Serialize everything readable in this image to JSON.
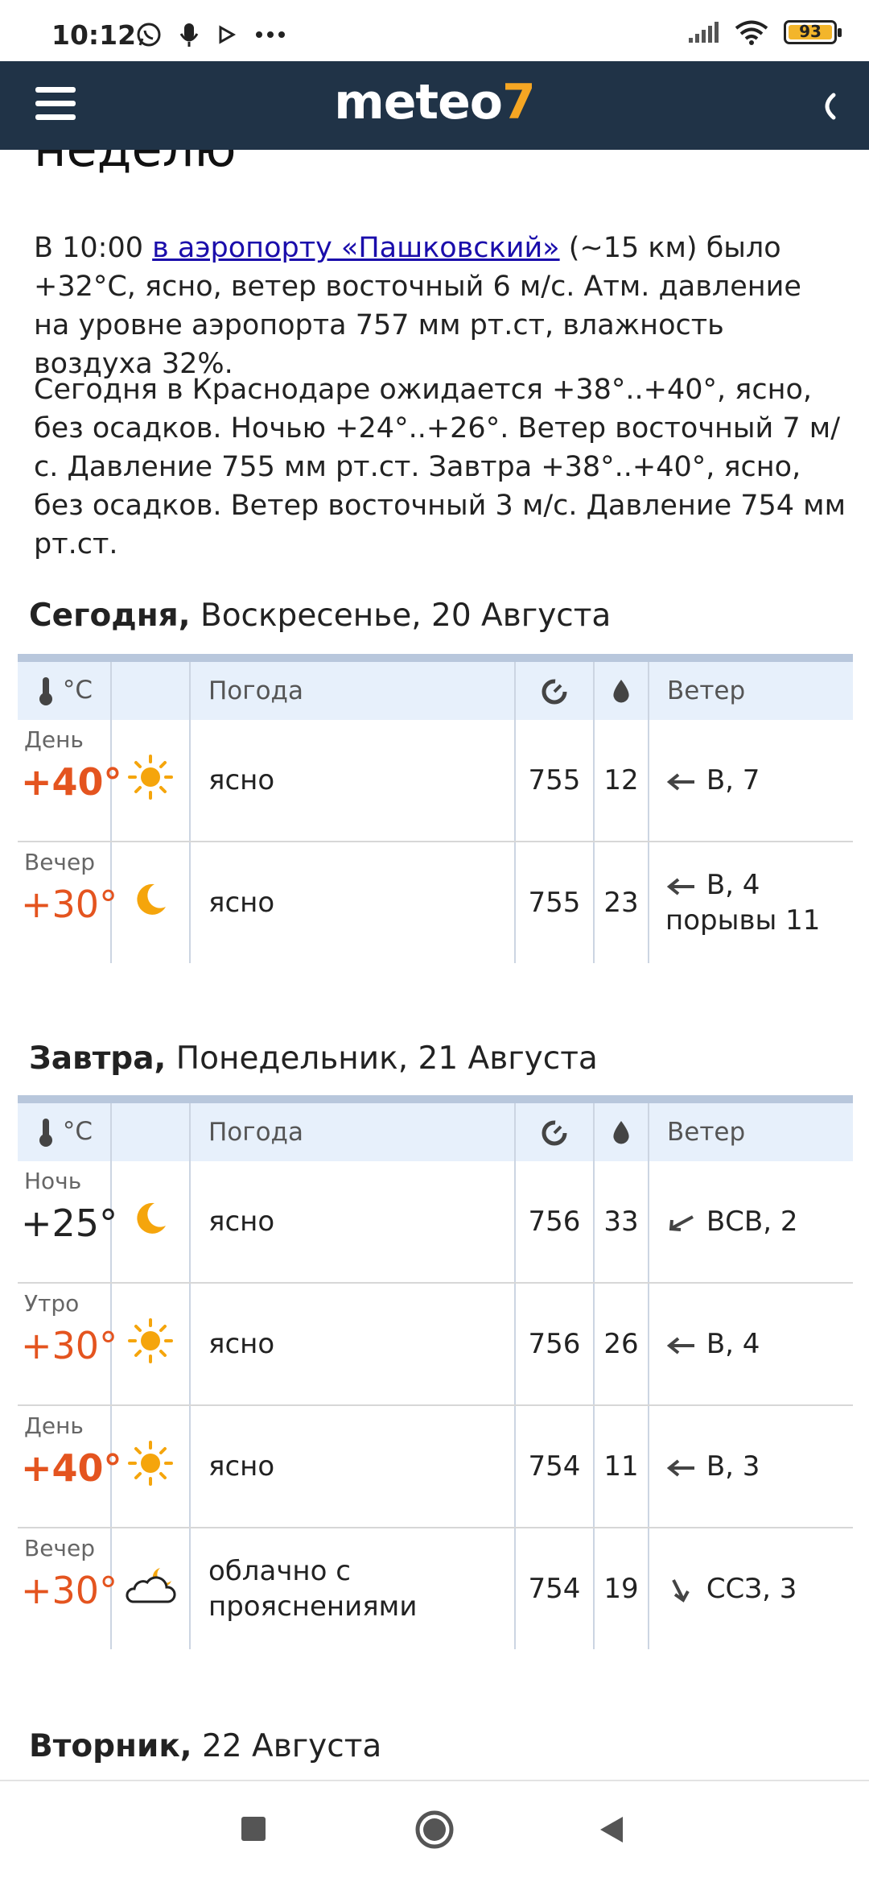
{
  "status_bar": {
    "time": "10:12",
    "battery": "93"
  },
  "header": {
    "logo_main": "meteo",
    "logo_accent": "7"
  },
  "page": {
    "heading_fragment": "неделю",
    "current_prefix": "В 10:00 ",
    "current_link": "в аэропорту «Пашковский»",
    "current_suffix": " (~15 км) было +32°C, ясно, ветер восточный 6 м/с. Атм. давление на уровне аэропорта 757 мм рт.ст, влажность воздуха 32%.",
    "forecast_text": "Сегодня в Краснодаре ожидается +38°..+40°, ясно, без осадков. Ночью +24°..+26°. Ветер восточный 7 м/с. Давление 755 мм рт.ст. Завтра +38°..+40°, ясно, без осадков. Ветер восточный 3 м/с. Давление 754 мм рт.ст."
  },
  "table_headers": {
    "temp_unit": "°C",
    "weather": "Погода",
    "wind": "Ветер"
  },
  "days": [
    {
      "title_bold": "Сегодня,",
      "title_rest": " Воскресенье, 20 Августа",
      "rows": [
        {
          "period": "День",
          "temp": "+40°",
          "icon": "sun-icon",
          "desc": "ясно",
          "pressure": "755",
          "humidity": "12",
          "wind_dir_icon": "arrow-left-icon",
          "wind": "В, 7",
          "gusts": ""
        },
        {
          "period": "Вечер",
          "temp": "+30°",
          "icon": "moon-icon",
          "desc": "ясно",
          "pressure": "755",
          "humidity": "23",
          "wind_dir_icon": "arrow-left-icon",
          "wind": "В, 4",
          "gusts": "порывы 11"
        }
      ]
    },
    {
      "title_bold": "Завтра,",
      "title_rest": " Понедельник, 21 Августа",
      "rows": [
        {
          "period": "Ночь",
          "temp": "+25°",
          "icon": "moon-icon",
          "desc": "ясно",
          "pressure": "756",
          "humidity": "33",
          "wind_dir_icon": "arrow-down-left-icon",
          "wind": "ВСВ, 2",
          "gusts": ""
        },
        {
          "period": "Утро",
          "temp": "+30°",
          "icon": "sun-icon",
          "desc": "ясно",
          "pressure": "756",
          "humidity": "26",
          "wind_dir_icon": "arrow-left-icon",
          "wind": "В, 4",
          "gusts": ""
        },
        {
          "period": "День",
          "temp": "+40°",
          "icon": "sun-icon",
          "desc": "ясно",
          "pressure": "754",
          "humidity": "11",
          "wind_dir_icon": "arrow-left-icon",
          "wind": "В, 3",
          "gusts": ""
        },
        {
          "period": "Вечер",
          "temp": "+30°",
          "icon": "cloud-moon-icon",
          "desc": "облачно с прояснениями",
          "pressure": "754",
          "humidity": "19",
          "wind_dir_icon": "arrow-down-right-icon",
          "wind": "ССЗ, 3",
          "gusts": ""
        }
      ]
    },
    {
      "title_bold": "Вторник,",
      "title_rest": " 22 Августа"
    }
  ],
  "colors": {
    "header_bg": "#203347",
    "accent": "#f5a623",
    "temp_warm": "#e4541f",
    "table_head_bg": "#e7f0fb",
    "link": "#1a0dab"
  }
}
